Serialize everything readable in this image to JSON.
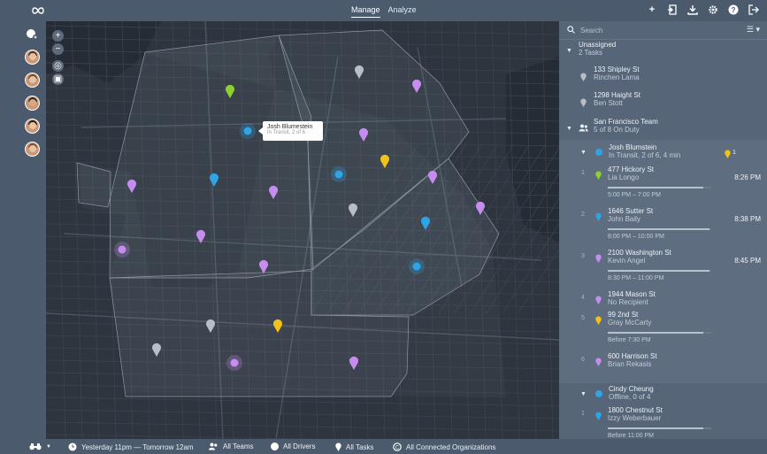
{
  "header": {
    "logo_icon": "infinity-logo",
    "tabs": [
      {
        "label": "Manage",
        "active": true
      },
      {
        "label": "Analyze",
        "active": false
      }
    ],
    "icons": [
      "plus-icon",
      "import-icon",
      "download-icon",
      "gear-icon",
      "help-icon",
      "logout-icon"
    ]
  },
  "map": {
    "tooltip": {
      "name": "Josh Blumestein",
      "status": "In Transit, 2 of 6"
    },
    "colors": {
      "purple": "#c68cf0",
      "blue": "#2ea3e6",
      "yellow": "#f2c21a",
      "green": "#8fd031",
      "gray": "#b7bec8"
    }
  },
  "panel": {
    "search_placeholder": "Search",
    "unassigned": {
      "title": "Unassigned",
      "subtitle": "2 Tasks",
      "tasks": [
        {
          "address": "133 Shipley St",
          "name": "Rinchen Lama"
        },
        {
          "address": "1298 Haight St",
          "name": "Ben Stott"
        }
      ]
    },
    "team": {
      "title": "San Francisco Team",
      "subtitle": "5 of 8 On Duty"
    },
    "driver1": {
      "name": "Josh Blumstein",
      "status": "In Transit, 2 of 6, 4 min",
      "badge": "1",
      "tasks": [
        {
          "num": "1",
          "address": "477 Hickory St",
          "name": "Lia Longo",
          "time": "8:26 PM",
          "window": "5:00 PM – 7:00 PM",
          "color": "#8fd031",
          "progress": 0.92
        },
        {
          "num": "2",
          "address": "1646 Sutter St",
          "name": "John Baily",
          "time": "8:38 PM",
          "window": "8:00 PM – 10:00 PM",
          "color": "#2ea3e6",
          "progress": 0.98
        },
        {
          "num": "3",
          "address": "2100 Washington St",
          "name": "Kevin Angel",
          "time": "8:45 PM",
          "window": "8:30 PM – 11:00 PM",
          "color": "#c68cf0",
          "progress": 0.98
        },
        {
          "num": "4",
          "address": "1944 Mason St",
          "name": "No Recipient",
          "time": "",
          "window": "",
          "color": "#c68cf0",
          "progress": 0
        },
        {
          "num": "5",
          "address": "99 2nd St",
          "name": "Gray McCarty",
          "time": "",
          "window": "Before 7:30 PM",
          "color": "#f2c21a",
          "progress": 0.92
        },
        {
          "num": "6",
          "address": "600 Harrison St",
          "name": "Brian Rekasis",
          "time": "",
          "window": "",
          "color": "#c68cf0",
          "progress": 0
        }
      ]
    },
    "driver2": {
      "name": "Cindy Cheung",
      "status": "Offline, 0 of 4",
      "tasks": [
        {
          "num": "1",
          "address": "1800 Chestnut St",
          "name": "Izzy Weberbauer",
          "time": "",
          "window": "Before 11:00 PM",
          "color": "#2ea3e6",
          "progress": 0.92
        }
      ]
    }
  },
  "footer": {
    "view_icon": "binoculars-icon",
    "time_range": "Yesterday 11pm — Tomorrow 12am",
    "teams": "All Teams",
    "drivers": "All Drivers",
    "tasks": "All Tasks",
    "orgs": "All Connected Organizations"
  }
}
